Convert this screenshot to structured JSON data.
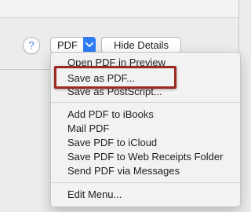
{
  "dialog": {
    "help_label": "?",
    "pdf_button_label": "PDF",
    "hide_details_label": "Hide Details"
  },
  "pdf_menu": {
    "items": [
      {
        "label": "Open PDF in Preview"
      },
      {
        "label": "Save as PDF..."
      },
      {
        "label": "Save as PostScript..."
      },
      {
        "label": "Add PDF to iBooks"
      },
      {
        "label": "Mail PDF"
      },
      {
        "label": "Save PDF to iCloud"
      },
      {
        "label": "Save PDF to Web Receipts Folder"
      },
      {
        "label": "Send PDF via Messages"
      },
      {
        "label": "Edit Menu..."
      }
    ]
  },
  "annotation": {
    "highlight_color": "#9c2a20",
    "highlighted_item": "Save as PDF..."
  },
  "colors": {
    "accent": "#2f7df6",
    "help_icon": "#3f7fd3"
  }
}
